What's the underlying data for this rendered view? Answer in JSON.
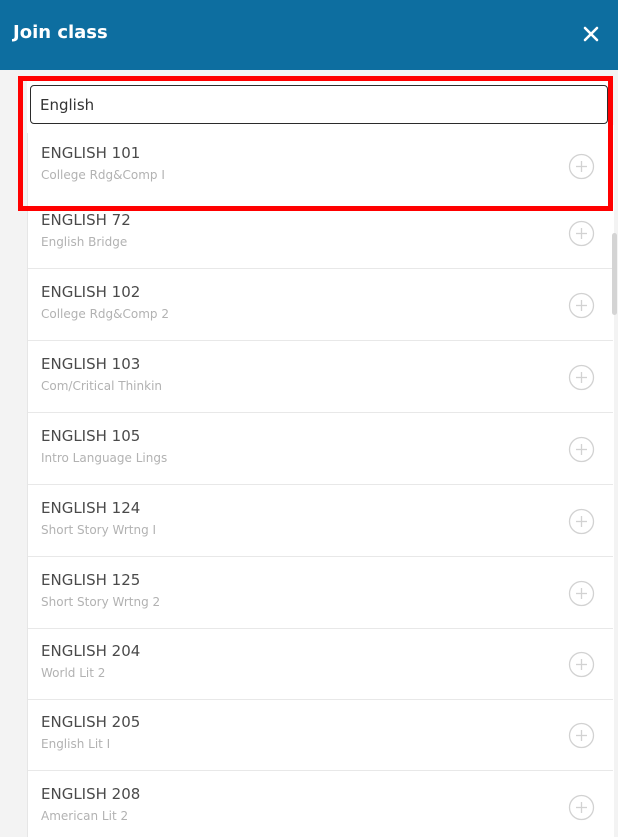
{
  "dialog": {
    "title": "Join class",
    "close_icon": "close-icon"
  },
  "search": {
    "value": "English",
    "placeholder": ""
  },
  "colors": {
    "header_bg": "#0d6ea0",
    "highlight": "#ff0000",
    "title_text": "#4a4a4a",
    "subtitle_text": "#b2b2b2"
  },
  "classes": [
    {
      "code": "ENGLISH 101",
      "name": "College Rdg&Comp I",
      "action_icon": "add-circle-icon"
    },
    {
      "code": "ENGLISH 72",
      "name": "English Bridge",
      "action_icon": "add-circle-icon"
    },
    {
      "code": "ENGLISH 102",
      "name": "College Rdg&Comp 2",
      "action_icon": "add-circle-icon"
    },
    {
      "code": "ENGLISH 103",
      "name": "Com/Critical Thinkin",
      "action_icon": "add-circle-icon"
    },
    {
      "code": "ENGLISH 105",
      "name": "Intro Language Lings",
      "action_icon": "add-circle-icon"
    },
    {
      "code": "ENGLISH 124",
      "name": "Short Story Wrtng I",
      "action_icon": "add-circle-icon"
    },
    {
      "code": "ENGLISH 125",
      "name": "Short Story Wrtng 2",
      "action_icon": "add-circle-icon"
    },
    {
      "code": "ENGLISH 204",
      "name": "World Lit 2",
      "action_icon": "add-circle-icon"
    },
    {
      "code": "ENGLISH 205",
      "name": "English Lit I",
      "action_icon": "add-circle-icon"
    },
    {
      "code": "ENGLISH 208",
      "name": "American Lit 2",
      "action_icon": "add-circle-icon"
    }
  ]
}
